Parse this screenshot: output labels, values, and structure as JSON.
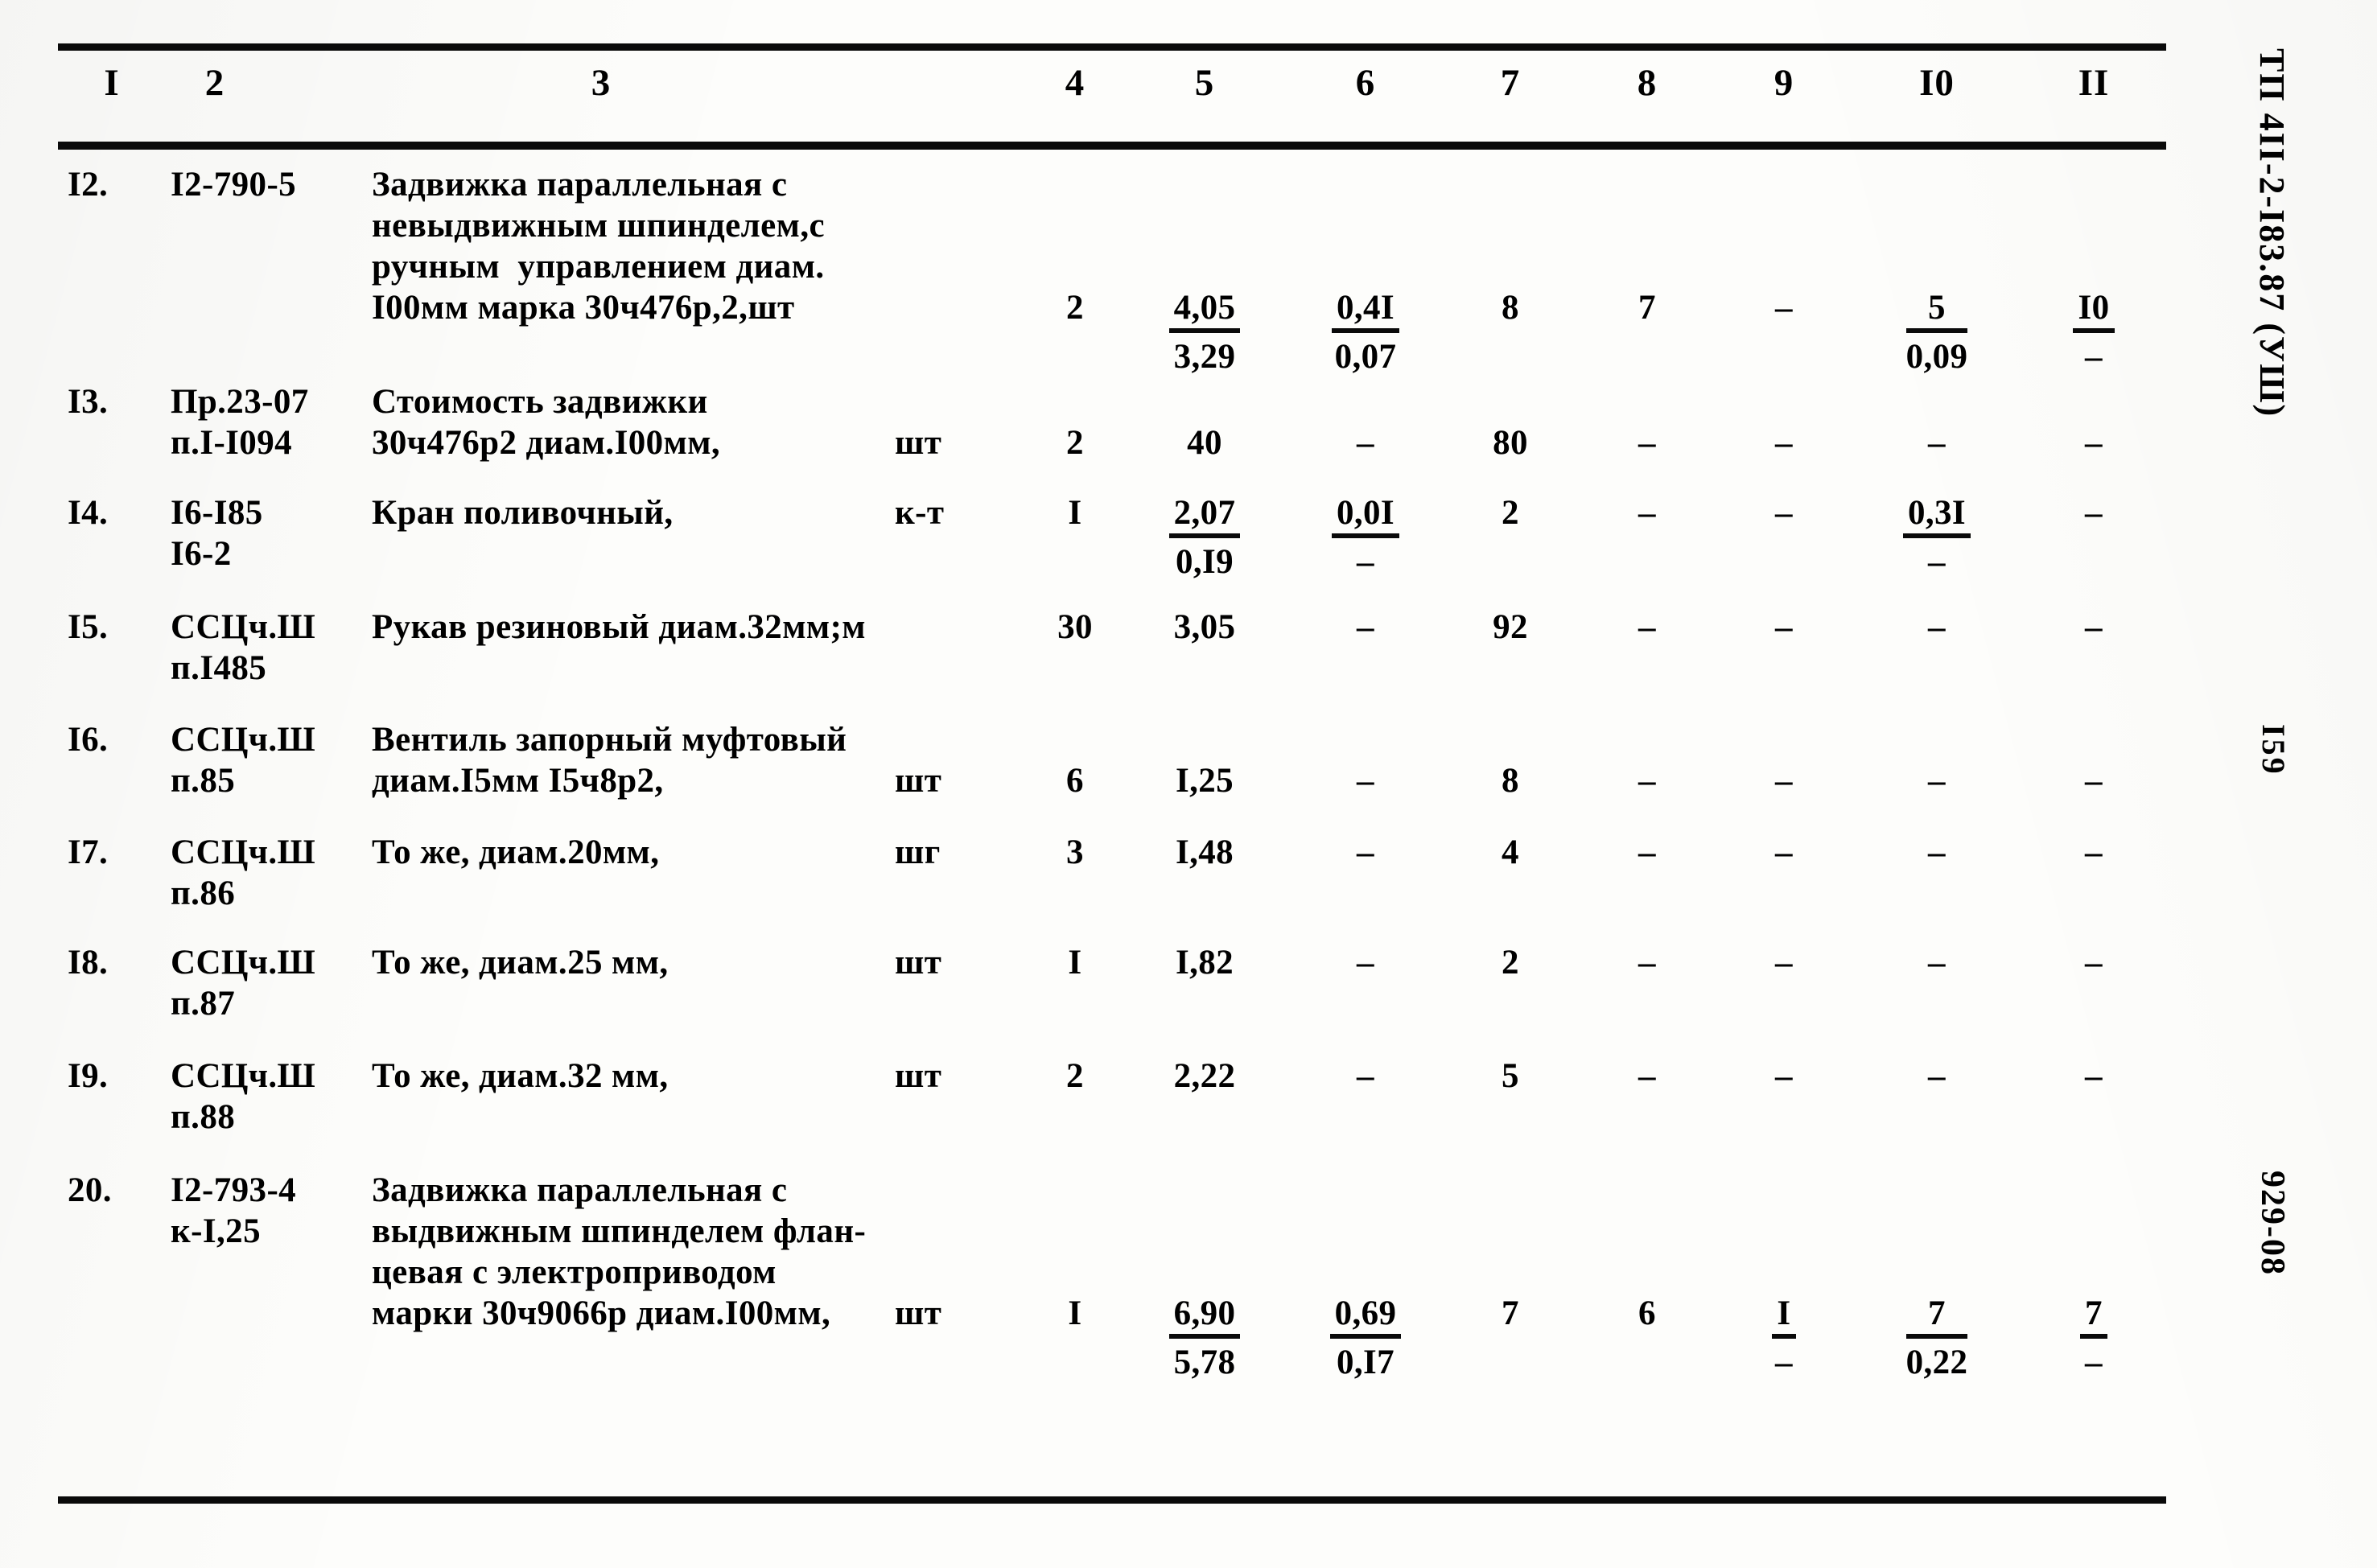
{
  "document": {
    "doc_code": "ТП 4II-2-I83.87  (УШ)",
    "page_number": "I59",
    "sheet_code": "929-08"
  },
  "table": {
    "column_headers": [
      "I",
      "2",
      "3",
      "4",
      "5",
      "6",
      "7",
      "8",
      "9",
      "I0",
      "II"
    ],
    "rows": [
      {
        "num": "I2.",
        "code": "I2-790-5",
        "code2": "",
        "desc_lines": [
          "Задвижка параллельная с",
          "невыдвижным шпинделем,с",
          "ручным  управлением диам.",
          "I00мм марка 30ч476р,2,шт"
        ],
        "unit": "",
        "qty": "2",
        "c5_top": "4,05",
        "c5_bot": "3,29",
        "c6_top": "0,4I",
        "c6_bot": "0,07",
        "c7": "8",
        "c8": "7",
        "c9": "–",
        "c10_top": "5",
        "c10_bot": "0,09",
        "c11_top": "I0",
        "c11_bot": "–"
      },
      {
        "num": "I3.",
        "code": "Пр.23-07",
        "code2": "п.I-I094",
        "desc_lines": [
          "Стоимость задвижки",
          "30ч476р2 диам.I00мм,"
        ],
        "unit": "шт",
        "qty": "2",
        "c5_top": "40",
        "c5_bot": "",
        "c6_top": "–",
        "c6_bot": "",
        "c7": "80",
        "c8": "–",
        "c9": "–",
        "c10_top": "–",
        "c10_bot": "",
        "c11_top": "–",
        "c11_bot": ""
      },
      {
        "num": "I4.",
        "code": "I6-I85",
        "code2": "I6-2",
        "desc_lines": [
          "Кран поливочный,"
        ],
        "unit": "к-т",
        "qty": "I",
        "c5_top": "2,07",
        "c5_bot": "0,I9",
        "c6_top": "0,0I",
        "c6_bot": "–",
        "c7": "2",
        "c8": "–",
        "c9": "–",
        "c10_top": "0,3I",
        "c10_bot": "–",
        "c11_top": "–",
        "c11_bot": ""
      },
      {
        "num": "I5.",
        "code": "ССЦч.Ш",
        "code2": "п.I485",
        "desc_lines": [
          "Рукав резиновый диам.32мм;м"
        ],
        "unit": "",
        "qty": "30",
        "c5_top": "3,05",
        "c5_bot": "",
        "c6_top": "–",
        "c6_bot": "",
        "c7": "92",
        "c8": "–",
        "c9": "–",
        "c10_top": "–",
        "c10_bot": "",
        "c11_top": "–",
        "c11_bot": ""
      },
      {
        "num": "I6.",
        "code": "ССЦч.Ш",
        "code2": "п.85",
        "desc_lines": [
          "Вентиль запорный муфтовый",
          "диам.I5мм I5ч8р2,"
        ],
        "unit": "шт",
        "qty": "6",
        "c5_top": "I,25",
        "c5_bot": "",
        "c6_top": "–",
        "c6_bot": "",
        "c7": "8",
        "c8": "–",
        "c9": "–",
        "c10_top": "–",
        "c10_bot": "",
        "c11_top": "–",
        "c11_bot": ""
      },
      {
        "num": "I7.",
        "code": "ССЦч.Ш",
        "code2": "п.86",
        "desc_lines": [
          "То же, диам.20мм,"
        ],
        "unit": "шг",
        "qty": "3",
        "c5_top": "I,48",
        "c5_bot": "",
        "c6_top": "–",
        "c6_bot": "",
        "c7": "4",
        "c8": "–",
        "c9": "–",
        "c10_top": "–",
        "c10_bot": "",
        "c11_top": "–",
        "c11_bot": ""
      },
      {
        "num": "I8.",
        "code": "ССЦч.Ш",
        "code2": "п.87",
        "desc_lines": [
          "То же, диам.25 мм,"
        ],
        "unit": "шт",
        "qty": "I",
        "c5_top": "I,82",
        "c5_bot": "",
        "c6_top": "–",
        "c6_bot": "",
        "c7": "2",
        "c8": "–",
        "c9": "–",
        "c10_top": "–",
        "c10_bot": "",
        "c11_top": "–",
        "c11_bot": ""
      },
      {
        "num": "I9.",
        "code": "ССЦч.Ш",
        "code2": "п.88",
        "desc_lines": [
          "То же, диам.32 мм,"
        ],
        "unit": "шт",
        "qty": "2",
        "c5_top": "2,22",
        "c5_bot": "",
        "c6_top": "–",
        "c6_bot": "",
        "c7": "5",
        "c8": "–",
        "c9": "–",
        "c10_top": "–",
        "c10_bot": "",
        "c11_top": "–",
        "c11_bot": ""
      },
      {
        "num": "20.",
        "code": "I2-793-4",
        "code2": "к-I,25",
        "desc_lines": [
          "Задвижка параллельная с",
          "выдвижным шпинделем флан-",
          "цевая с электроприводом",
          "марки 30ч9066р диам.I00мм,"
        ],
        "unit": "шт",
        "qty": "I",
        "c5_top": "6,90",
        "c5_bot": "5,78",
        "c6_top": "0,69",
        "c6_bot": "0,I7",
        "c7": "7",
        "c8": "6",
        "c9_top": "I",
        "c9_bot": "–",
        "c10_top": "7",
        "c10_bot": "0,22",
        "c11_top": "7",
        "c11_bot": "–"
      }
    ]
  }
}
